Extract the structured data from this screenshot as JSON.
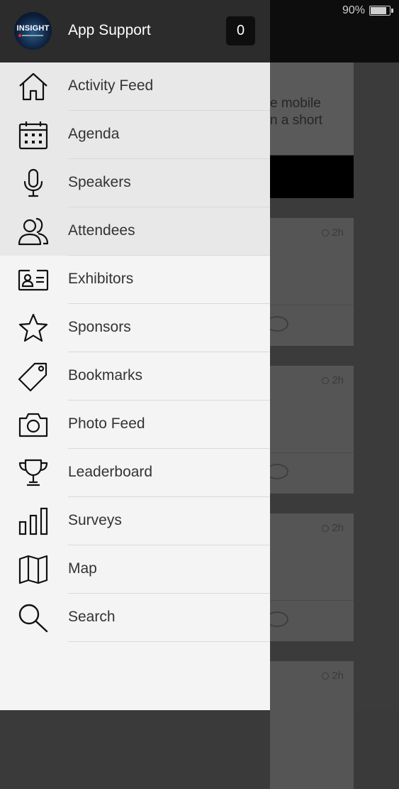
{
  "status": {
    "battery": "90%"
  },
  "header": {
    "title": "App Support",
    "badge": "0",
    "logo_text": "INSIGHT"
  },
  "menu": [
    {
      "label": "Activity Feed",
      "icon": "home-icon",
      "active": true
    },
    {
      "label": "Agenda",
      "icon": "calendar-icon",
      "active": true
    },
    {
      "label": "Speakers",
      "icon": "microphone-icon",
      "active": true
    },
    {
      "label": "Attendees",
      "icon": "people-icon",
      "active": true
    },
    {
      "label": "Exhibitors",
      "icon": "id-card-icon",
      "active": false
    },
    {
      "label": "Sponsors",
      "icon": "star-icon",
      "active": false
    },
    {
      "label": "Bookmarks",
      "icon": "tag-icon",
      "active": false
    },
    {
      "label": "Photo Feed",
      "icon": "camera-icon",
      "active": false
    },
    {
      "label": "Leaderboard",
      "icon": "trophy-icon",
      "active": false
    },
    {
      "label": "Surveys",
      "icon": "bar-chart-icon",
      "active": false
    },
    {
      "label": "Map",
      "icon": "map-icon",
      "active": false
    },
    {
      "label": "Search",
      "icon": "search-icon",
      "active": false
    }
  ],
  "background": {
    "card_text_line1": "e mobile",
    "card_text_line2": "n a short",
    "post_times": [
      "2h",
      "2h",
      "2h",
      "2h"
    ]
  }
}
